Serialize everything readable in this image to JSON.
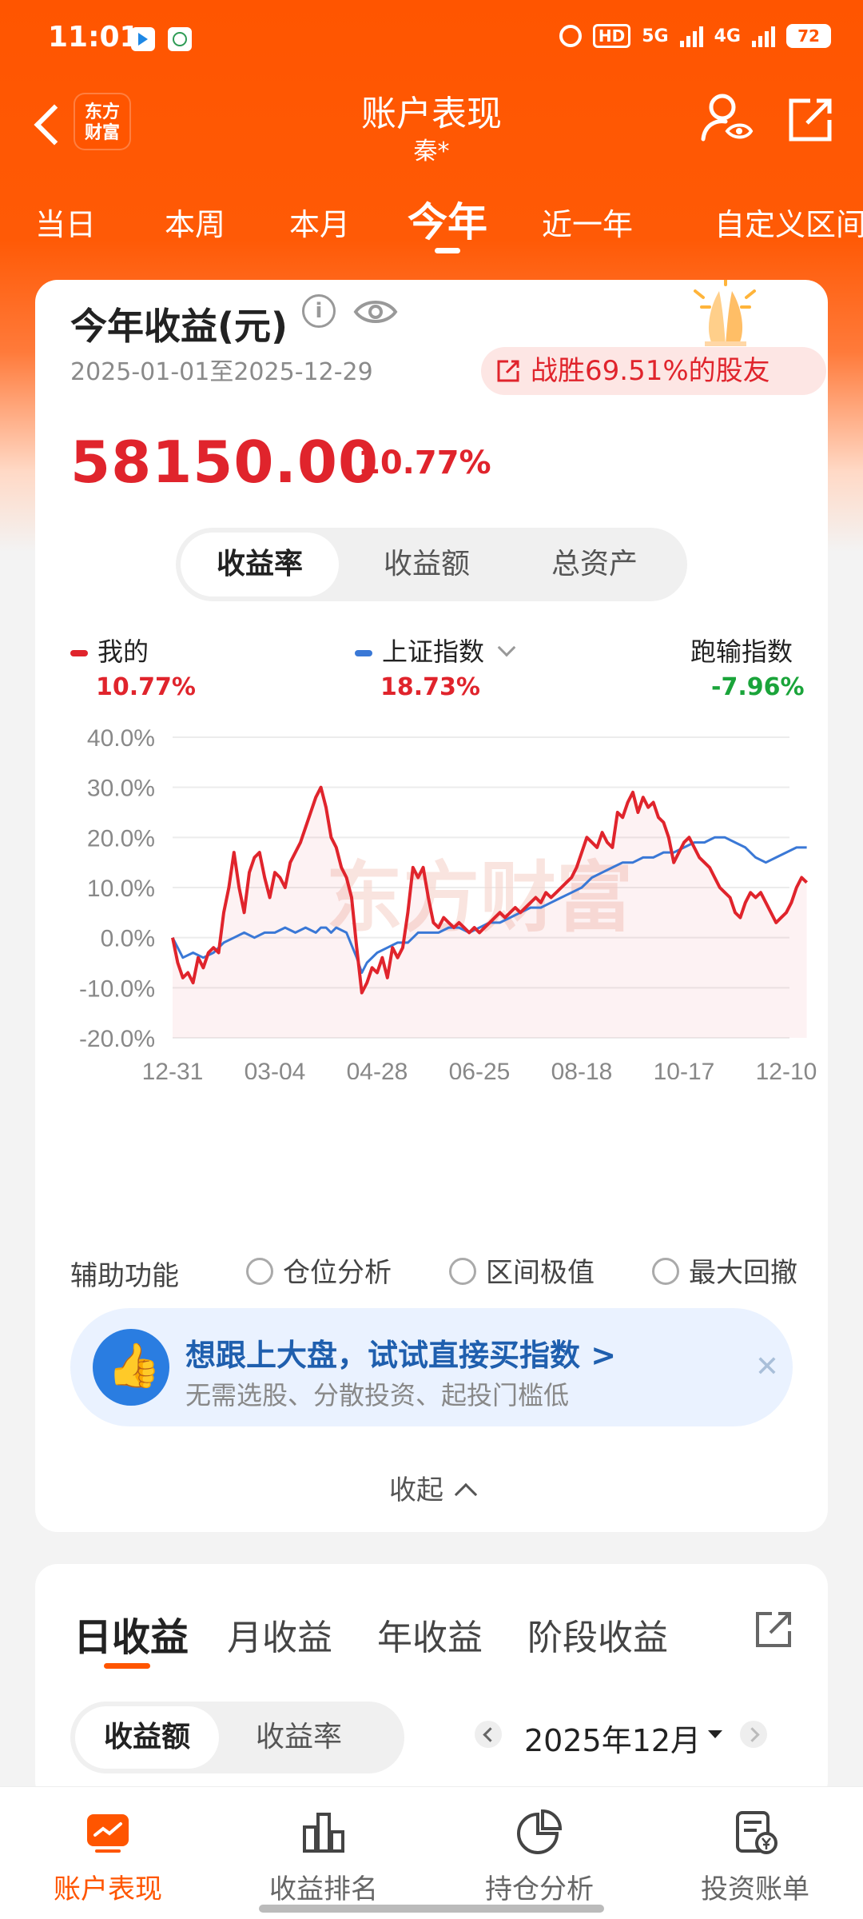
{
  "status_bar": {
    "time": "11:01",
    "hd": "HD",
    "net1": "5G",
    "net2": "4G",
    "battery": "72"
  },
  "header": {
    "logo_line1": "东方",
    "logo_line2": "财富",
    "title": "账户表现",
    "subtitle": "秦*"
  },
  "period_tabs": [
    {
      "label": "当日",
      "active": false
    },
    {
      "label": "本周",
      "active": false
    },
    {
      "label": "本月",
      "active": false
    },
    {
      "label": "今年",
      "active": true
    },
    {
      "label": "近一年",
      "active": false
    },
    {
      "label": "自定义区间",
      "active": false
    }
  ],
  "summary": {
    "title": "今年收益(元)",
    "info_icon": "i",
    "date_range": "2025-01-01至2025-12-29",
    "beat_text": "战胜69.51%的股友",
    "amount": "58150.00",
    "percent": "10.77%"
  },
  "metric_toggle": [
    "收益率",
    "收益额",
    "总资产"
  ],
  "legend": {
    "mine_label": "我的",
    "mine_value": "10.77%",
    "index_label": "上证指数",
    "index_value": "18.73%",
    "diff_label": "跑输指数",
    "diff_value": "-7.96%"
  },
  "colors": {
    "brand": "#ff5500",
    "mine": "#e0242c",
    "index": "#3a78d6",
    "loss": "#1aa43a"
  },
  "chart_data": {
    "type": "line",
    "x_ticks": [
      "12-31",
      "03-04",
      "04-28",
      "06-25",
      "08-18",
      "10-17",
      "12-10"
    ],
    "y_ticks": [
      "40.0%",
      "30.0%",
      "20.0%",
      "10.0%",
      "0.0%",
      "-10.0%",
      "-20.0%"
    ],
    "ylim": [
      -20,
      40
    ],
    "x_index_range": [
      0,
      240
    ],
    "watermark": "东方财富",
    "series": [
      {
        "name": "我的",
        "points": [
          [
            0,
            0
          ],
          [
            2,
            -5
          ],
          [
            4,
            -8
          ],
          [
            6,
            -7
          ],
          [
            8,
            -9
          ],
          [
            10,
            -4
          ],
          [
            12,
            -6
          ],
          [
            14,
            -3
          ],
          [
            16,
            -2
          ],
          [
            18,
            -3
          ],
          [
            20,
            5
          ],
          [
            22,
            10
          ],
          [
            24,
            17
          ],
          [
            26,
            10
          ],
          [
            28,
            5
          ],
          [
            30,
            13
          ],
          [
            32,
            16
          ],
          [
            34,
            17
          ],
          [
            36,
            12
          ],
          [
            38,
            8
          ],
          [
            40,
            13
          ],
          [
            42,
            12
          ],
          [
            44,
            10
          ],
          [
            46,
            15
          ],
          [
            48,
            17
          ],
          [
            50,
            19
          ],
          [
            52,
            22
          ],
          [
            54,
            25
          ],
          [
            56,
            28
          ],
          [
            58,
            30
          ],
          [
            60,
            26
          ],
          [
            62,
            20
          ],
          [
            64,
            18
          ],
          [
            66,
            14
          ],
          [
            68,
            12
          ],
          [
            70,
            8
          ],
          [
            72,
            -2
          ],
          [
            74,
            -11
          ],
          [
            76,
            -9
          ],
          [
            78,
            -6
          ],
          [
            80,
            -7
          ],
          [
            82,
            -4
          ],
          [
            84,
            -8
          ],
          [
            86,
            -2
          ],
          [
            88,
            -4
          ],
          [
            90,
            -2
          ],
          [
            92,
            5
          ],
          [
            94,
            14
          ],
          [
            96,
            12
          ],
          [
            98,
            14
          ],
          [
            100,
            8
          ],
          [
            102,
            3
          ],
          [
            104,
            2
          ],
          [
            106,
            4
          ],
          [
            108,
            3
          ],
          [
            110,
            2
          ],
          [
            112,
            3
          ],
          [
            114,
            2
          ],
          [
            116,
            1
          ],
          [
            118,
            2
          ],
          [
            120,
            1
          ],
          [
            122,
            2
          ],
          [
            124,
            3
          ],
          [
            126,
            4
          ],
          [
            128,
            5
          ],
          [
            130,
            4
          ],
          [
            132,
            5
          ],
          [
            134,
            6
          ],
          [
            136,
            5
          ],
          [
            138,
            6
          ],
          [
            140,
            7
          ],
          [
            142,
            8
          ],
          [
            144,
            7
          ],
          [
            146,
            9
          ],
          [
            148,
            8
          ],
          [
            150,
            9
          ],
          [
            152,
            10
          ],
          [
            154,
            11
          ],
          [
            156,
            12
          ],
          [
            158,
            14
          ],
          [
            160,
            17
          ],
          [
            162,
            20
          ],
          [
            164,
            19
          ],
          [
            166,
            18
          ],
          [
            168,
            21
          ],
          [
            170,
            19
          ],
          [
            172,
            18
          ],
          [
            174,
            25
          ],
          [
            176,
            24
          ],
          [
            178,
            27
          ],
          [
            180,
            29
          ],
          [
            182,
            25
          ],
          [
            184,
            28
          ],
          [
            186,
            26
          ],
          [
            188,
            27
          ],
          [
            190,
            24
          ],
          [
            192,
            23
          ],
          [
            194,
            20
          ],
          [
            196,
            15
          ],
          [
            198,
            17
          ],
          [
            200,
            19
          ],
          [
            202,
            20
          ],
          [
            204,
            18
          ],
          [
            206,
            16
          ],
          [
            208,
            15
          ],
          [
            210,
            14
          ],
          [
            212,
            12
          ],
          [
            214,
            10
          ],
          [
            216,
            9
          ],
          [
            218,
            8
          ],
          [
            220,
            5
          ],
          [
            222,
            4
          ],
          [
            224,
            7
          ],
          [
            226,
            9
          ],
          [
            228,
            8
          ],
          [
            230,
            9
          ],
          [
            232,
            7
          ],
          [
            234,
            5
          ],
          [
            236,
            3
          ],
          [
            238,
            4
          ],
          [
            240,
            5
          ],
          [
            242,
            7
          ],
          [
            244,
            10
          ],
          [
            246,
            12
          ],
          [
            248,
            11
          ]
        ]
      },
      {
        "name": "上证指数",
        "points": [
          [
            0,
            0
          ],
          [
            4,
            -4
          ],
          [
            8,
            -3
          ],
          [
            12,
            -4
          ],
          [
            16,
            -3
          ],
          [
            20,
            -1
          ],
          [
            24,
            0
          ],
          [
            28,
            1
          ],
          [
            32,
            0
          ],
          [
            36,
            1
          ],
          [
            40,
            1
          ],
          [
            44,
            2
          ],
          [
            48,
            1
          ],
          [
            52,
            2
          ],
          [
            56,
            1
          ],
          [
            58,
            2
          ],
          [
            60,
            2
          ],
          [
            62,
            1
          ],
          [
            64,
            2
          ],
          [
            68,
            1
          ],
          [
            72,
            -4
          ],
          [
            74,
            -7
          ],
          [
            76,
            -5
          ],
          [
            80,
            -3
          ],
          [
            84,
            -2
          ],
          [
            88,
            -1
          ],
          [
            92,
            -1
          ],
          [
            96,
            1
          ],
          [
            100,
            1
          ],
          [
            104,
            1
          ],
          [
            108,
            2
          ],
          [
            112,
            2
          ],
          [
            116,
            1
          ],
          [
            120,
            2
          ],
          [
            124,
            3
          ],
          [
            128,
            3
          ],
          [
            132,
            4
          ],
          [
            136,
            5
          ],
          [
            140,
            6
          ],
          [
            144,
            6
          ],
          [
            148,
            7
          ],
          [
            152,
            8
          ],
          [
            156,
            9
          ],
          [
            160,
            10
          ],
          [
            164,
            12
          ],
          [
            168,
            13
          ],
          [
            172,
            14
          ],
          [
            176,
            15
          ],
          [
            180,
            15
          ],
          [
            184,
            16
          ],
          [
            188,
            16
          ],
          [
            192,
            17
          ],
          [
            196,
            17
          ],
          [
            200,
            18
          ],
          [
            204,
            19
          ],
          [
            208,
            19
          ],
          [
            212,
            20
          ],
          [
            216,
            20
          ],
          [
            220,
            19
          ],
          [
            224,
            18
          ],
          [
            228,
            16
          ],
          [
            232,
            15
          ],
          [
            236,
            16
          ],
          [
            240,
            17
          ],
          [
            244,
            18
          ],
          [
            248,
            18
          ]
        ]
      }
    ]
  },
  "aux": {
    "label": "辅助功能",
    "options": [
      "仓位分析",
      "区间极值",
      "最大回撤"
    ]
  },
  "promo": {
    "headline": "想跟上大盘，试试直接买指数 >",
    "subtext": "无需选股、分散投资、起投门槛低",
    "close": "✕"
  },
  "collapse_label": "收起",
  "income_tabs": [
    "日收益",
    "月收益",
    "年收益",
    "阶段收益"
  ],
  "amount_toggle": [
    "收益额",
    "收益率"
  ],
  "month_selector": "2025年12月",
  "bottom_nav": [
    {
      "label": "账户表现",
      "icon": "chart-icon",
      "active": true
    },
    {
      "label": "收益排名",
      "icon": "bar-icon",
      "active": false
    },
    {
      "label": "持仓分析",
      "icon": "pie-icon",
      "active": false
    },
    {
      "label": "投资账单",
      "icon": "bill-icon",
      "active": false
    }
  ]
}
